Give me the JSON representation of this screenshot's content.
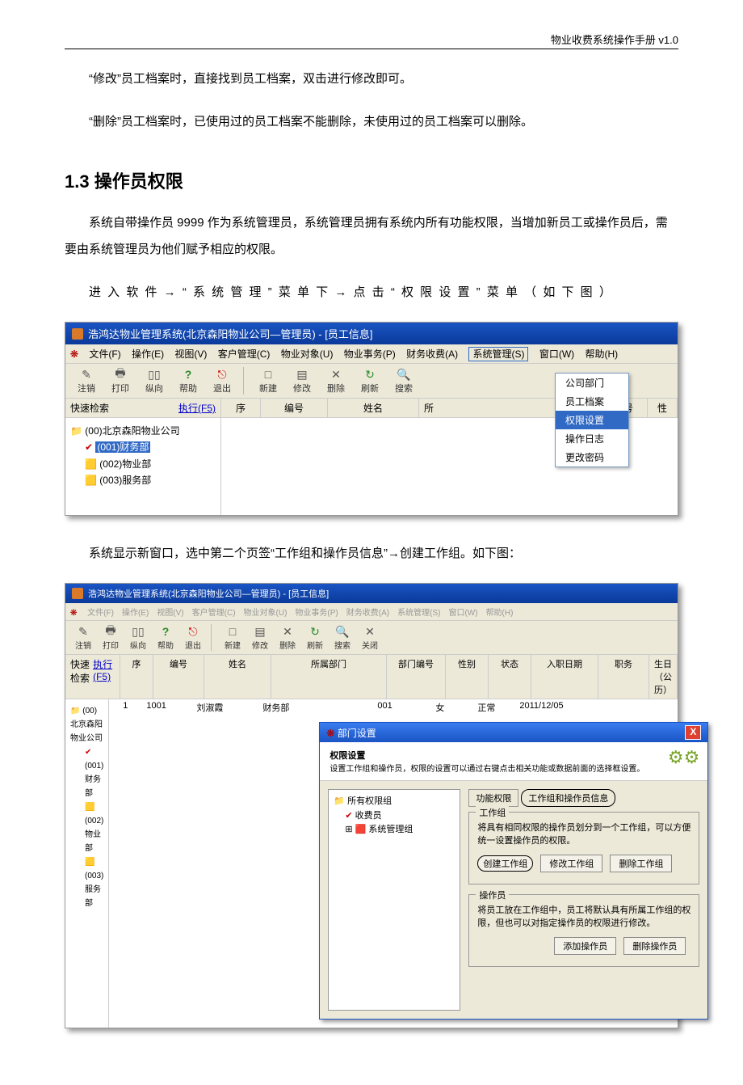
{
  "header": "物业收费系统操作手册 v1.0",
  "p1": "“修改”员工档案时，直接找到员工档案，双击进行修改即可。",
  "p2": "“删除”员工档案时，已使用过的员工档案不能删除，未使用过的员工档案可以删除。",
  "h2": "1.3 操作员权限",
  "p3": "系统自带操作员 9999 作为系统管理员，系统管理员拥有系统内所有功能权限，当增加新员工或操作员后，需要由系统管理员为他们赋予相应的权限。",
  "p4": "进 入 软 件 → “ 系 统 管 理 ” 菜 单 下 → 点 击 “ 权 限 设 置 ” 菜 单 （ 如 下 图 ）",
  "p5": "系统显示新窗口，选中第二个页签“工作组和操作员信息”→创建工作组。如下图：",
  "win1": {
    "title": "浩鸿达物业管理系统(北京森阳物业公司—管理员) - [员工信息]",
    "menus": [
      "文件(F)",
      "操作(E)",
      "视图(V)",
      "客户管理(C)",
      "物业对象(U)",
      "物业事务(P)",
      "财务收费(A)",
      "系统管理(S)",
      "窗口(W)",
      "帮助(H)"
    ],
    "tools": [
      {
        "i": "✎",
        "t": "注销"
      },
      {
        "i": "🖶",
        "t": "打印"
      },
      {
        "i": "▯▯",
        "t": "纵向"
      },
      {
        "i": "?",
        "t": "帮助"
      },
      {
        "i": "⎋",
        "t": "退出"
      },
      {
        "i": "□",
        "t": "新建"
      },
      {
        "i": "▤",
        "t": "修改"
      },
      {
        "i": "✕",
        "t": "删除"
      },
      {
        "i": "↻",
        "t": "刷新"
      },
      {
        "i": "🔍",
        "t": "搜索"
      }
    ],
    "quick": "快速检索",
    "exec": "执行(F5)",
    "cols": [
      "序",
      "编号",
      "姓名",
      "所",
      "部门编号",
      "性"
    ],
    "tree": {
      "root": "(00)北京森阳物业公司",
      "sel": "(001)财务部",
      "i2": "(002)物业部",
      "i3": "(003)服务部"
    },
    "popup": [
      "公司部门",
      "员工档案",
      "权限设置",
      "操作日志",
      "更改密码"
    ]
  },
  "win2": {
    "title": "浩鸿达物业管理系统(北京森阳物业公司—管理员) - [员工信息]",
    "tools": [
      {
        "i": "✎",
        "t": "注销"
      },
      {
        "i": "🖶",
        "t": "打印"
      },
      {
        "i": "▯▯",
        "t": "纵向"
      },
      {
        "i": "?",
        "t": "帮助"
      },
      {
        "i": "⎋",
        "t": "退出"
      },
      {
        "i": "□",
        "t": "新建"
      },
      {
        "i": "▤",
        "t": "修改"
      },
      {
        "i": "✕",
        "t": "删除"
      },
      {
        "i": "↻",
        "t": "刷新"
      },
      {
        "i": "🔍",
        "t": "搜索"
      },
      {
        "i": "✕",
        "t": "关闭"
      }
    ],
    "cols": [
      "序",
      "编号",
      "姓名",
      "所属部门",
      "部门编号",
      "性别",
      "状态",
      "入职日期",
      "职务",
      "生日（公历）"
    ],
    "row": {
      "n": "1",
      "id": "1001",
      "name": "刘淑霞",
      "dept": "财务部",
      "dno": "001",
      "sex": "女",
      "st": "正常",
      "date": "2011/12/05"
    },
    "tree": {
      "root": "(00)北京森阳物业公司",
      "i1": "(001)财务部",
      "i2": "(002)物业部",
      "i3": "(003)服务部"
    },
    "dlg": {
      "title": "部门设置",
      "h": "权限设置",
      "sub": "设置工作组和操作员，权限的设置可以通过右键点击相关功能或数据前面的选择框设置。",
      "treeRoot": "所有权限组",
      "t1": "收费员",
      "t2": "系统管理组",
      "tab1": "功能权限",
      "tab2": "工作组和操作员信息",
      "g1": "工作组",
      "g1txt": "将具有相同权限的操作员划分到一个工作组，可以方便统一设置操作员的权限。",
      "b1": "创建工作组",
      "b2": "修改工作组",
      "b3": "删除工作组",
      "g2": "操作员",
      "g2txt": "将员工放在工作组中，员工将默认具有所属工作组的权限，但也可以对指定操作员的权限进行修改。",
      "b4": "添加操作员",
      "b5": "删除操作员"
    }
  }
}
